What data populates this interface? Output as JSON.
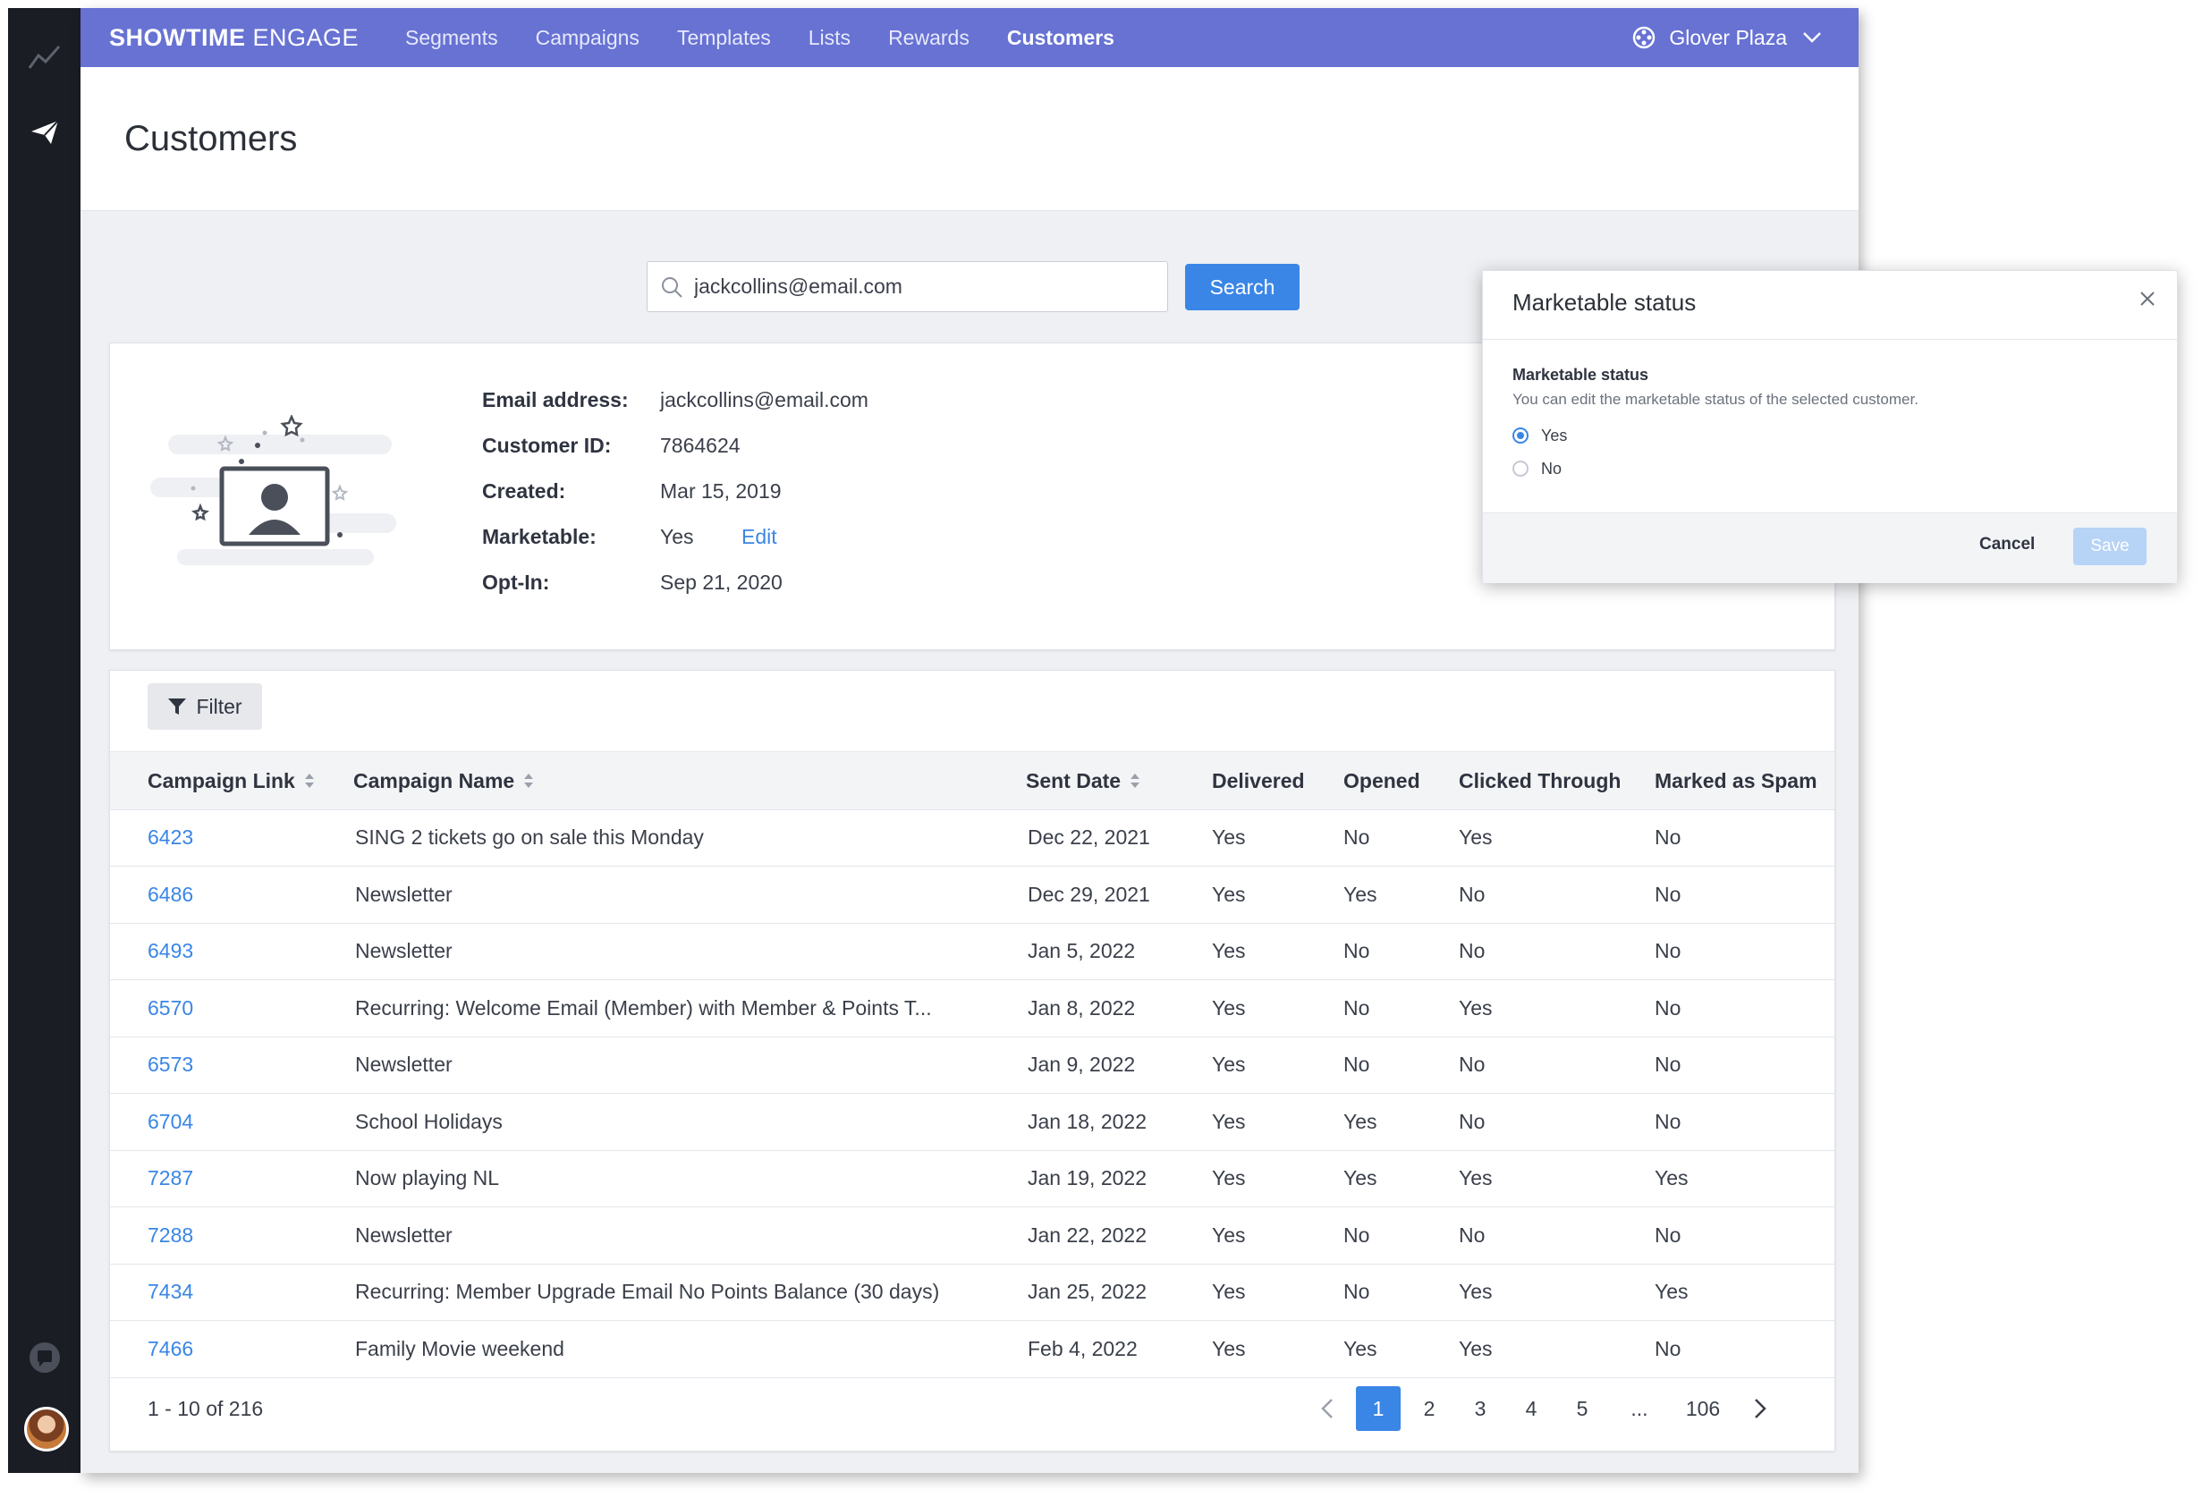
{
  "rail": {
    "icons": [
      "analytics-icon",
      "send-icon",
      "chat-icon"
    ]
  },
  "nav": {
    "brand_bold": "SHOWTIME",
    "brand_rest": "ENGAGE",
    "items": [
      "Segments",
      "Campaigns",
      "Templates",
      "Lists",
      "Rewards",
      "Customers"
    ],
    "active": "Customers",
    "venue": "Glover Plaza"
  },
  "page": {
    "title": "Customers"
  },
  "search": {
    "value": "jackcollins@email.com",
    "button": "Search"
  },
  "profile": {
    "fields": [
      {
        "label": "Email address:",
        "value": "jackcollins@email.com"
      },
      {
        "label": "Customer ID:",
        "value": "7864624"
      },
      {
        "label": "Created:",
        "value": "Mar 15, 2019"
      },
      {
        "label": "Marketable:",
        "value": "Yes"
      },
      {
        "label": "Opt-In:",
        "value": "Sep 21,  2020"
      }
    ],
    "edit_label": "Edit"
  },
  "table": {
    "filter_label": "Filter",
    "columns": [
      "Campaign Link",
      "Campaign Name",
      "Sent Date",
      "Delivered",
      "Opened",
      "Clicked Through",
      "Marked as Spam"
    ],
    "rows": [
      [
        "6423",
        "SING 2 tickets go on sale this Monday",
        "Dec 22, 2021",
        "Yes",
        "No",
        "Yes",
        "No"
      ],
      [
        "6486",
        "Newsletter",
        "Dec 29, 2021",
        "Yes",
        "Yes",
        "No",
        "No"
      ],
      [
        "6493",
        "Newsletter",
        "Jan 5, 2022",
        "Yes",
        "No",
        "No",
        "No"
      ],
      [
        "6570",
        "Recurring: Welcome Email (Member) with Member & Points T...",
        "Jan 8, 2022",
        "Yes",
        "No",
        "Yes",
        "No"
      ],
      [
        "6573",
        "Newsletter",
        "Jan 9, 2022",
        "Yes",
        "No",
        "No",
        "No"
      ],
      [
        "6704",
        "School Holidays",
        "Jan 18, 2022",
        "Yes",
        "Yes",
        "No",
        "No"
      ],
      [
        "7287",
        "Now playing NL",
        "Jan 19, 2022",
        "Yes",
        "Yes",
        "Yes",
        "Yes"
      ],
      [
        "7288",
        "Newsletter",
        "Jan 22, 2022",
        "Yes",
        "No",
        "No",
        "No"
      ],
      [
        "7434",
        "Recurring: Member Upgrade Email No Points Balance (30 days)",
        "Jan 25, 2022",
        "Yes",
        "No",
        "Yes",
        "Yes"
      ],
      [
        "7466",
        "Family Movie weekend",
        "Feb 4, 2022",
        "Yes",
        "Yes",
        "Yes",
        "No"
      ]
    ],
    "range": "1 - 10 of 216",
    "pages": [
      "1",
      "2",
      "3",
      "4",
      "5",
      "...",
      "106"
    ],
    "current_page": "1"
  },
  "dialog": {
    "title": "Marketable status",
    "label": "Marketable status",
    "help": "You can edit the marketable status of the selected customer.",
    "options": [
      "Yes",
      "No"
    ],
    "selected": "Yes",
    "cancel": "Cancel",
    "save": "Save"
  },
  "colors": {
    "nav": "#6772d3",
    "accent": "#3a86e6",
    "rail": "#1a1d24"
  }
}
